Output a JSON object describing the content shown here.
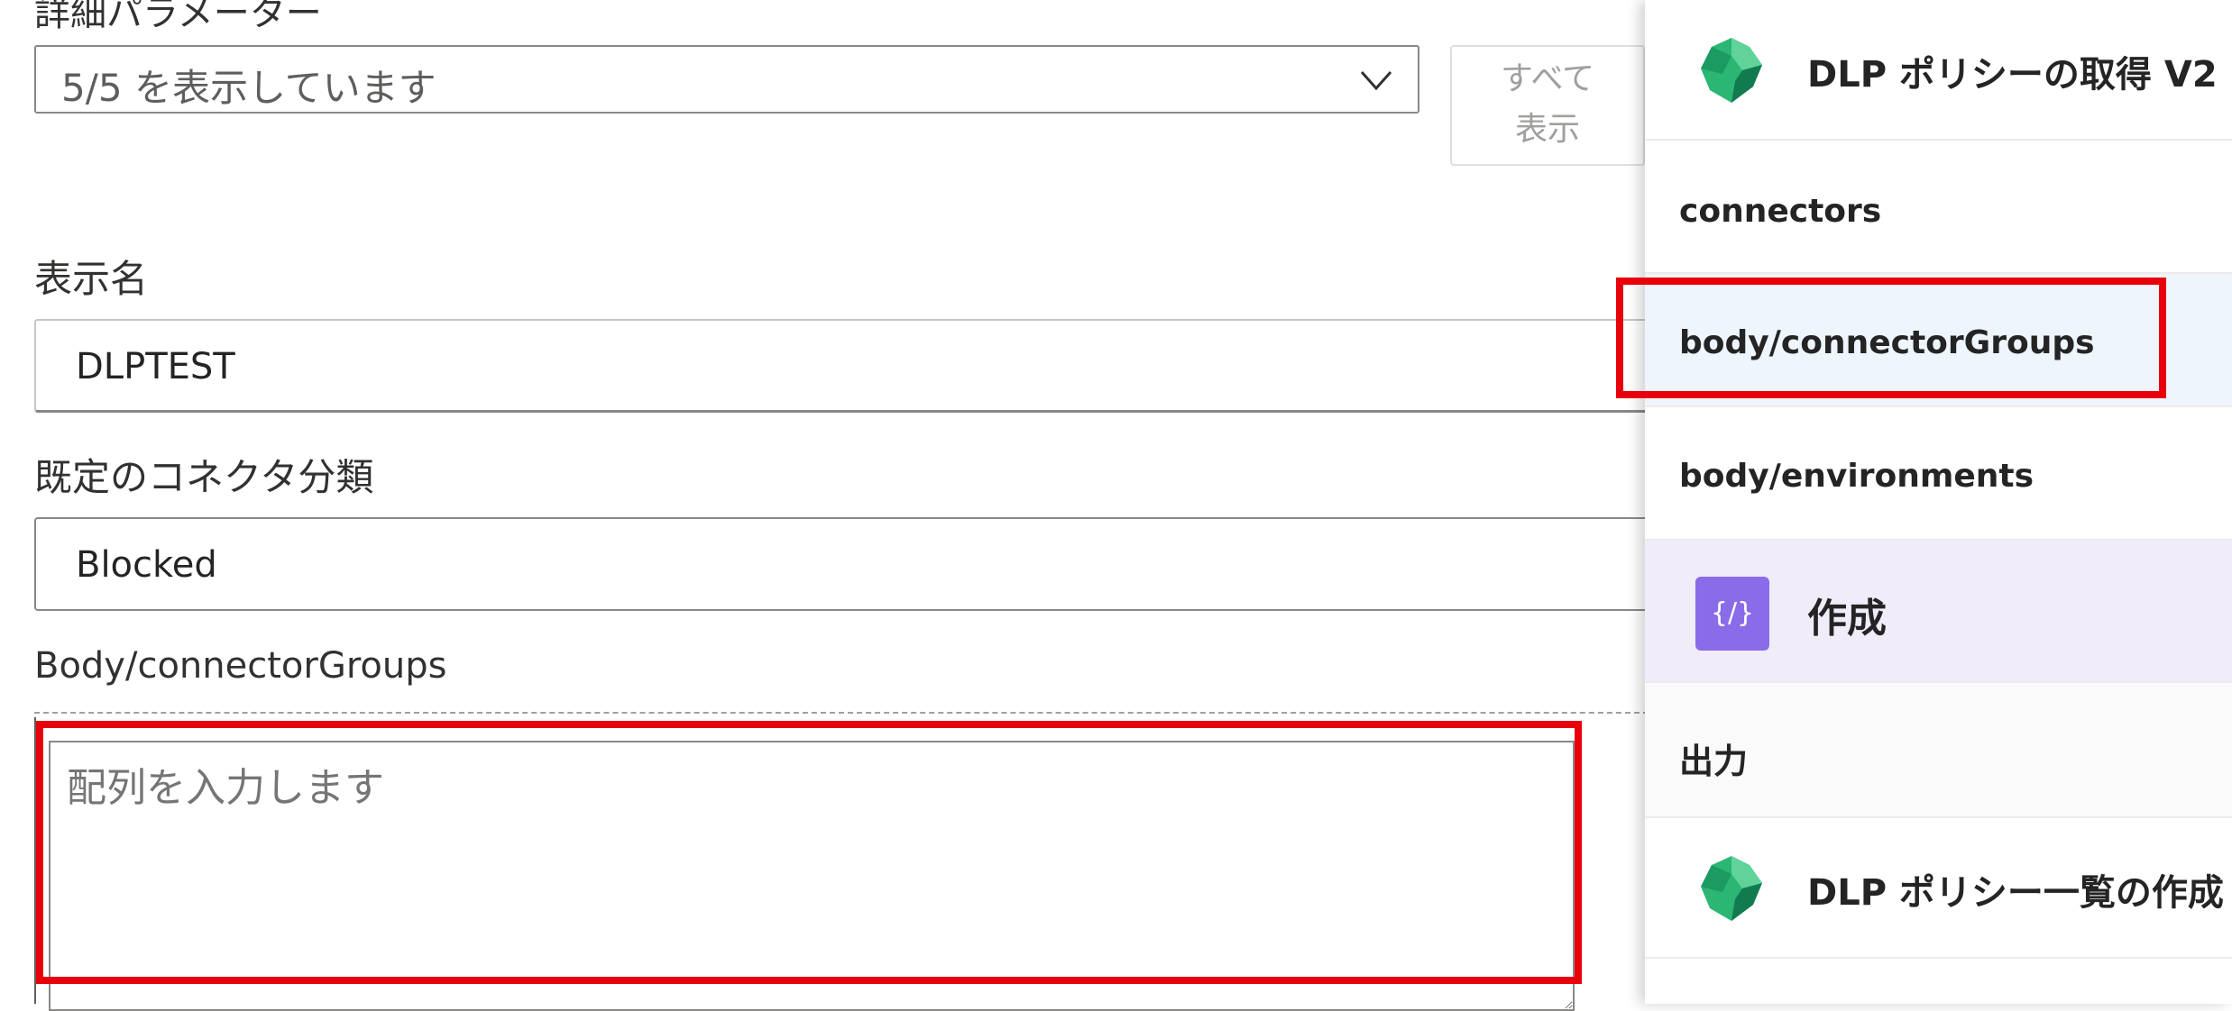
{
  "form": {
    "section_title": "詳細パラメーター",
    "params_select_value": "5/5 を表示しています",
    "show_all_line1": "すべて",
    "show_all_line2": "表示",
    "display_name_label": "表示名",
    "display_name_value": "DLPTEST",
    "default_class_label": "既定のコネクタ分類",
    "default_class_value": "Blocked",
    "body_groups_label": "Body/connectorGroups",
    "array_placeholder": "配列を入力します"
  },
  "panel": {
    "action1_title": "DLP ポリシーの取得 V2",
    "item_connectors": "connectors",
    "item_connector_groups": "body/connectorGroups",
    "item_environments": "body/environments",
    "compose_title": "作成",
    "compose_icon_glyph": "{/}",
    "output_label": "出力",
    "action2_title": "DLP ポリシー一覧の作成"
  },
  "colors": {
    "highlight": "#e8000b",
    "selected_row": "#eef5fc",
    "compose_accent": "#8a6ce8",
    "dlp_icon_green": "#1fa86a"
  },
  "icons": {
    "dlp_icon": "dlp-policy-icon",
    "compose_icon": "compose-icon",
    "dropdown": "chevron-down-icon"
  }
}
